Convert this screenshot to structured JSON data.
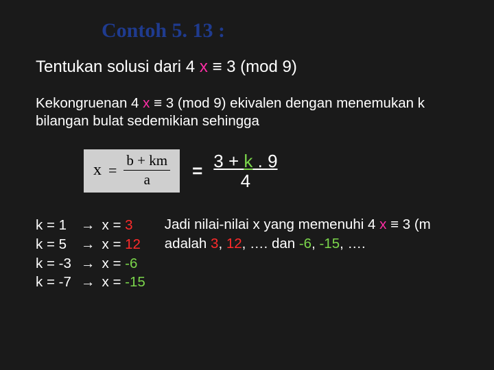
{
  "title": "Contoh  5. 13 :",
  "problem": {
    "prefix": "Tentukan solusi dari  4 ",
    "x": "x",
    "suffix": " ≡ 3 (mod 9)"
  },
  "body": {
    "line1a": "Kekongruenan 4 ",
    "x": "x",
    "line1b": " ≡ 3 (mod 9) ekivalen dengan menemukan k",
    "line2": "bilangan bulat sedemikian sehingga"
  },
  "formula_box": {
    "x": "x",
    "eq": "=",
    "num": "b + km",
    "den": "a"
  },
  "rhs": {
    "eq": "=",
    "num_prefix": "3 + ",
    "num_k": "k",
    "num_dot": " . ",
    "num_nine": "9",
    "den": "4"
  },
  "ktable": [
    {
      "k": "k = 1",
      "arrow": "→",
      "xlabel": "x = ",
      "val": "3",
      "sign": "pos"
    },
    {
      "k": "k = 5",
      "arrow": "→",
      "xlabel": "x = ",
      "val": "12",
      "sign": "pos"
    },
    {
      "k": "k = -3",
      "arrow": "→",
      "xlabel": "x = ",
      "val": "-6",
      "sign": "neg"
    },
    {
      "k": "k = -7",
      "arrow": "→",
      "xlabel": "x = ",
      "val": "-15",
      "sign": "neg"
    }
  ],
  "conclusion": {
    "l1a": "Jadi nilai-nilai x yang memenuhi 4 ",
    "l1x": "x",
    "l1b": " ≡ 3 (m",
    "l2a": "adalah ",
    "p3": "3",
    "c1": ", ",
    "p12": "12",
    "c2": ", …. dan ",
    "n6": "-6",
    "c3": ", ",
    "n15": "-15",
    "c4": ", …."
  }
}
